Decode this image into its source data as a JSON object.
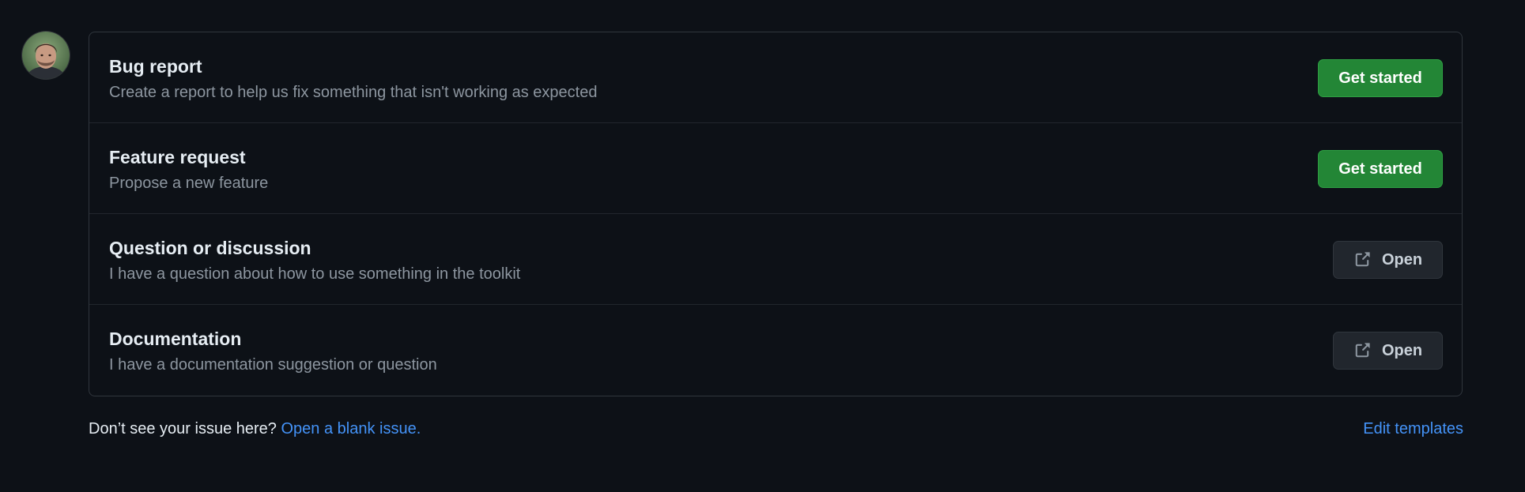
{
  "avatar": {
    "alt": "user avatar"
  },
  "templates": [
    {
      "title": "Bug report",
      "description": "Create a report to help us fix something that isn't working as expected",
      "action_label": "Get started",
      "action_type": "primary"
    },
    {
      "title": "Feature request",
      "description": "Propose a new feature",
      "action_label": "Get started",
      "action_type": "primary"
    },
    {
      "title": "Question or discussion",
      "description": "I have a question about how to use something in the toolkit",
      "action_label": "Open",
      "action_type": "external",
      "icon": "link-external-icon"
    },
    {
      "title": "Documentation",
      "description": "I have a documentation suggestion or question",
      "action_label": "Open",
      "action_type": "external",
      "icon": "link-external-icon"
    }
  ],
  "footer": {
    "prompt": "Don’t see your issue here? ",
    "blank_issue_link": "Open a blank issue.",
    "edit_templates_link": "Edit templates"
  },
  "colors": {
    "background": "#0d1117",
    "border": "#30363d",
    "primary_button": "#238636",
    "link": "#4493f8",
    "muted_text": "#8d96a0"
  }
}
